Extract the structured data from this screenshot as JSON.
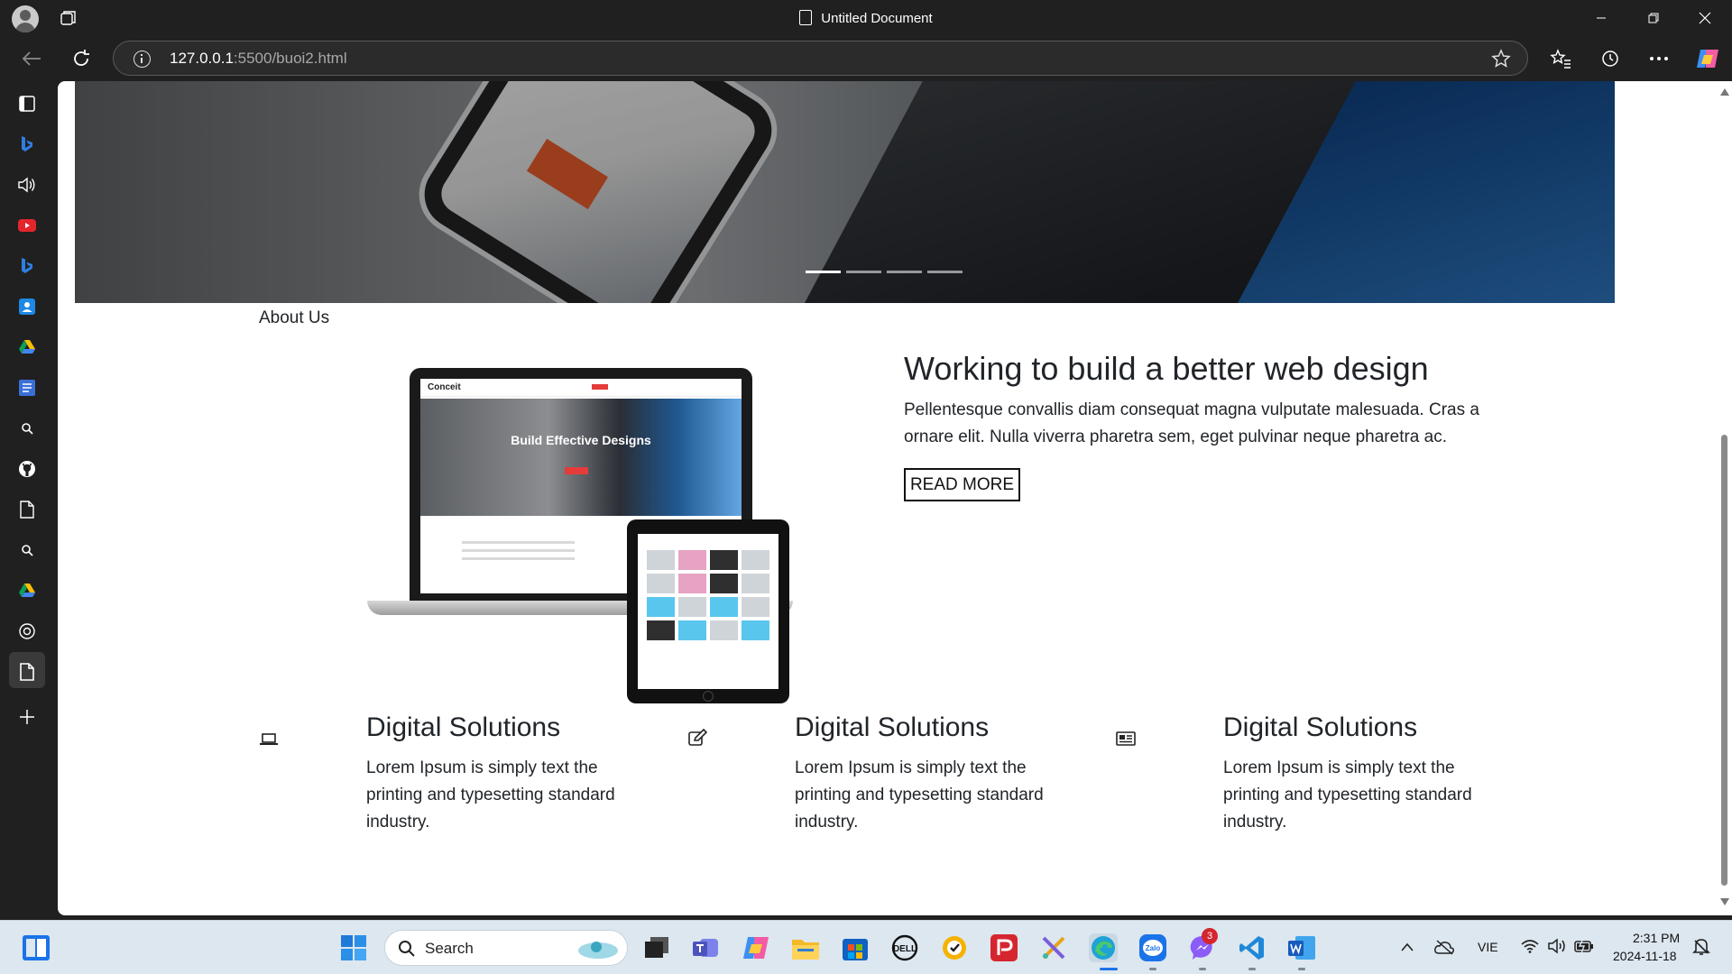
{
  "window": {
    "title": "Untitled Document"
  },
  "browser": {
    "url_host": "127.0.0.1",
    "url_path": ":5500/buoi2.html"
  },
  "page": {
    "about_heading": "About Us",
    "feature": {
      "title": "Working to build a better web design",
      "text": "Pellentesque convallis diam consequat magna vulputate malesuada. Cras a ornare elit. Nulla viverra pharetra sem, eget pulvinar neque pharetra ac.",
      "button": "READ MORE"
    },
    "mockup": {
      "brand": "Conceit",
      "banner_title": "Build Effective Designs"
    },
    "carousel": {
      "slide_count": 4,
      "active_slide": 1
    },
    "services": [
      {
        "icon": "laptop-icon",
        "title": "Digital Solutions",
        "text": "Lorem Ipsum is simply text the printing and typesetting standard industry."
      },
      {
        "icon": "edit-icon",
        "title": "Digital Solutions",
        "text": "Lorem Ipsum is simply text the printing and typesetting standard industry."
      },
      {
        "icon": "newspaper-icon",
        "title": "Digital Solutions",
        "text": "Lorem Ipsum is simply text the printing and typesetting standard industry."
      }
    ]
  },
  "taskbar": {
    "search_label": "Search",
    "messenger_badge": "3",
    "language": "VIE",
    "time": "2:31 PM",
    "date": "2024-11-18"
  },
  "colors": {
    "chrome_bg": "#202020",
    "page_bg": "#ffffff",
    "text": "#212529",
    "taskbar_bg": "#dce7ef"
  }
}
